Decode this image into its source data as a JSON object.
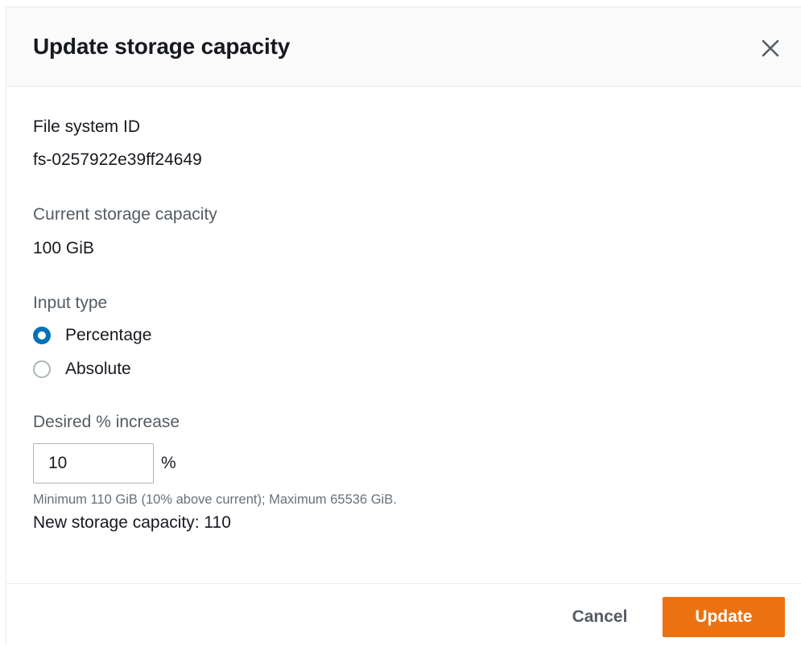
{
  "dialog": {
    "title": "Update storage capacity",
    "close_icon": "close-icon"
  },
  "file_system": {
    "label": "File system ID",
    "value": "fs-0257922e39ff24649"
  },
  "current_capacity": {
    "label": "Current storage capacity",
    "value": "100 GiB"
  },
  "input_type": {
    "label": "Input type",
    "options": [
      {
        "label": "Percentage",
        "selected": true
      },
      {
        "label": "Absolute",
        "selected": false
      }
    ]
  },
  "desired_increase": {
    "label": "Desired % increase",
    "value": "10",
    "unit": "%",
    "hint": "Minimum 110 GiB (10% above current); Maximum 65536 GiB.",
    "new_capacity": "New storage capacity: 110"
  },
  "footer": {
    "cancel_label": "Cancel",
    "update_label": "Update"
  },
  "colors": {
    "primary_button": "#ec7211",
    "radio_selected": "#0073bb",
    "header_background": "#fafafa"
  }
}
